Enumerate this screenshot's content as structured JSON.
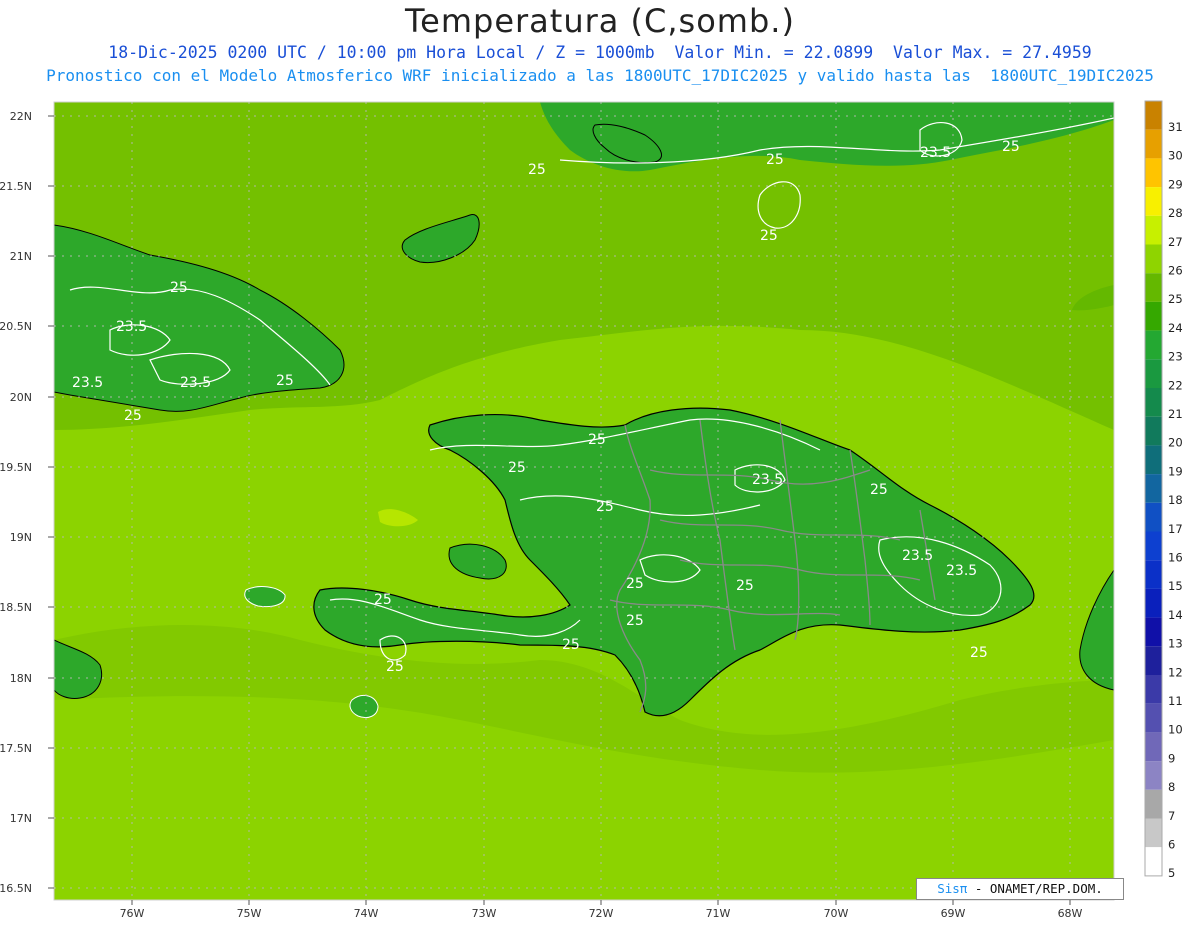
{
  "title": "Temperatura (C,somb.)",
  "subtitle_line1": "18-Dic-2025 0200 UTC / 10:00 pm Hora Local / Z = 1000mb  Valor Min. = 22.0899  Valor Max. = 27.4959",
  "subtitle_line2": "Pronostico con el Modelo Atmosferico WRF inicializado a las 1800UTC_17DIC2025 y valido hasta las  1800UTC_19DIC2025",
  "lat_labels": [
    "22N",
    "21.5N",
    "21N",
    "20.5N",
    "20N",
    "19.5N",
    "19N",
    "18.5N",
    "18N",
    "17.5N",
    "17N",
    "16.5N"
  ],
  "lon_labels": [
    "76W",
    "75W",
    "74W",
    "73W",
    "72W",
    "71W",
    "70W",
    "69W",
    "68W"
  ],
  "contour_labels": [
    {
      "text": "25"
    },
    {
      "text": "25"
    },
    {
      "text": "25"
    },
    {
      "text": "23.5"
    },
    {
      "text": "25"
    },
    {
      "text": "25"
    },
    {
      "text": "23.5"
    },
    {
      "text": "23.5"
    },
    {
      "text": "23.5"
    },
    {
      "text": "25"
    },
    {
      "text": "25"
    },
    {
      "text": "25"
    },
    {
      "text": "25"
    },
    {
      "text": "25"
    },
    {
      "text": "23.5"
    },
    {
      "text": "25"
    },
    {
      "text": "25"
    },
    {
      "text": "25"
    },
    {
      "text": "25"
    },
    {
      "text": "25"
    },
    {
      "text": "23.5"
    },
    {
      "text": "23.5"
    },
    {
      "text": "25"
    },
    {
      "text": "25"
    },
    {
      "text": "25"
    }
  ],
  "colorbar": {
    "levels": [
      "31",
      "30",
      "29",
      "28",
      "27",
      "26",
      "25",
      "24",
      "23",
      "22",
      "21",
      "20",
      "19",
      "18",
      "17",
      "16",
      "15",
      "14",
      "13",
      "12",
      "11",
      "10",
      "9",
      "8",
      "7",
      "6",
      "5"
    ],
    "colors": [
      "#c98200",
      "#e7a000",
      "#ffc400",
      "#f8f000",
      "#c7f000",
      "#8fd400",
      "#64b800",
      "#35a800",
      "#24a832",
      "#1a9940",
      "#148a4c",
      "#117a5c",
      "#0f6e7a",
      "#1266a0",
      "#1050c4",
      "#0d40d0",
      "#0b30c8",
      "#0a20bc",
      "#1010a8",
      "#1e209c",
      "#3b3aa8",
      "#5450b0",
      "#7068b8",
      "#8c84c4",
      "#a8a8a8",
      "#c8c8c8",
      "#ffffff"
    ]
  },
  "credit": {
    "sis": "Sisπ",
    "rest": "- ONAMET/REP.DOM."
  },
  "field_colors": {
    "sea_light": "#8cd300",
    "sea_mid": "#79c200",
    "sea_dark": "#64b800",
    "land": "#2da82a",
    "contour": "#ffffff",
    "coast": "#000000",
    "borders": "#8a8a8a"
  }
}
